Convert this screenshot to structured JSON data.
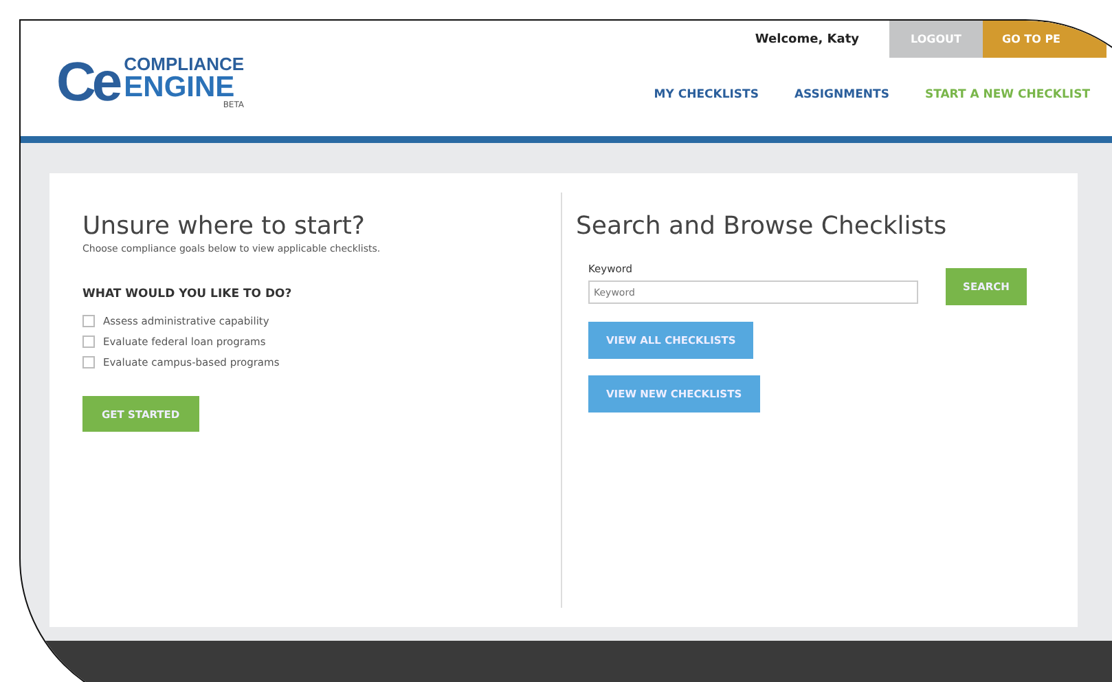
{
  "header": {
    "logo": {
      "mark": "Ce",
      "line1": "COMPLIANCE",
      "line2": "ENGINE",
      "tag": "BETA"
    },
    "welcome": "Welcome, Katy",
    "logout": "LOGOUT",
    "goto": "GO TO PE",
    "nav": [
      {
        "label": "MY CHECKLISTS",
        "kind": "link"
      },
      {
        "label": "ASSIGNMENTS",
        "kind": "link"
      },
      {
        "label": "START A NEW CHECKLIST",
        "kind": "action"
      }
    ]
  },
  "left": {
    "title": "Unsure where to start?",
    "subtitle": "Choose compliance goals below to view applicable checklists.",
    "question": "WHAT WOULD YOU LIKE TO DO?",
    "options": [
      {
        "label": "Assess administrative capability",
        "checked": false
      },
      {
        "label": "Evaluate federal loan programs",
        "checked": false
      },
      {
        "label": "Evaluate campus-based programs",
        "checked": false
      }
    ],
    "button": "GET STARTED"
  },
  "right": {
    "title": "Search and Browse Checklists",
    "field_label": "Keyword",
    "placeholder": "Keyword",
    "search": "SEARCH",
    "buttons": [
      "VIEW ALL CHECKLISTS",
      "VIEW NEW CHECKLISTS"
    ]
  }
}
